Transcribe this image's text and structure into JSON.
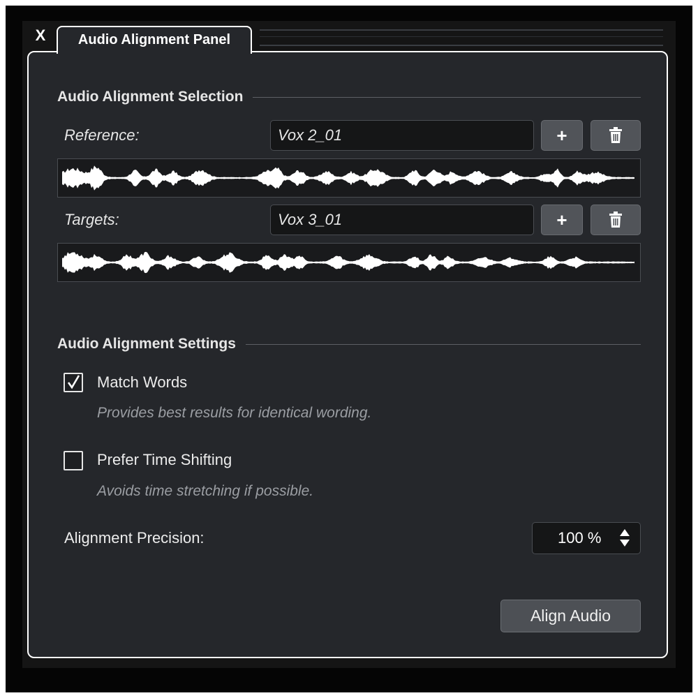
{
  "window": {
    "close_label": "X",
    "tab_title": "Audio Alignment Panel"
  },
  "selection": {
    "title": "Audio Alignment Selection",
    "reference": {
      "label": "Reference:",
      "value": "Vox 2_01",
      "add_label": "+"
    },
    "targets": {
      "label": "Targets:",
      "value": "Vox 3_01",
      "add_label": "+"
    },
    "delete_icon": "trash-icon"
  },
  "settings": {
    "title": "Audio Alignment Settings",
    "match_words": {
      "label": "Match Words",
      "checked": true,
      "hint": "Provides best results for identical wording."
    },
    "prefer_time_shifting": {
      "label": "Prefer Time Shifting",
      "checked": false,
      "hint": "Avoids time stretching if possible."
    },
    "precision": {
      "label": "Alignment Precision:",
      "value": "100 %"
    }
  },
  "actions": {
    "align_label": "Align Audio"
  }
}
